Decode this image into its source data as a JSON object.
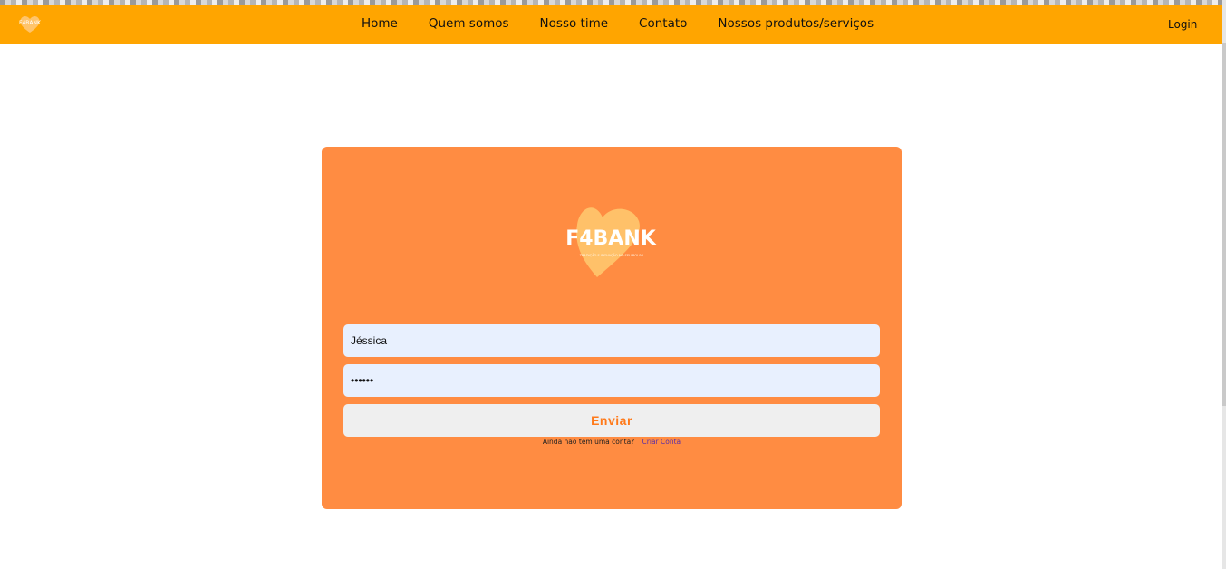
{
  "nav": {
    "logo_text": "F4BANK",
    "links": [
      "Home",
      "Quem somos",
      "Nosso time",
      "Contato",
      "Nossos produtos/serviços"
    ],
    "login_label": "Login"
  },
  "login_card": {
    "logo_text": "F4BANK",
    "logo_tagline": "TRADIÇÃO E INOVAÇÃO NO SEU BOLSO",
    "username_value": "Jéssica",
    "password_value": "••••••",
    "submit_label": "Enviar",
    "signup_prompt": "Ainda não tem uma conta?",
    "signup_link": "Criar Conta"
  },
  "colors": {
    "navbar": "#ffa500",
    "card": "#ff8c42",
    "input_bg": "#e8f0fe",
    "submit_text": "#ff7a1a",
    "link": "#5b2ea6"
  }
}
